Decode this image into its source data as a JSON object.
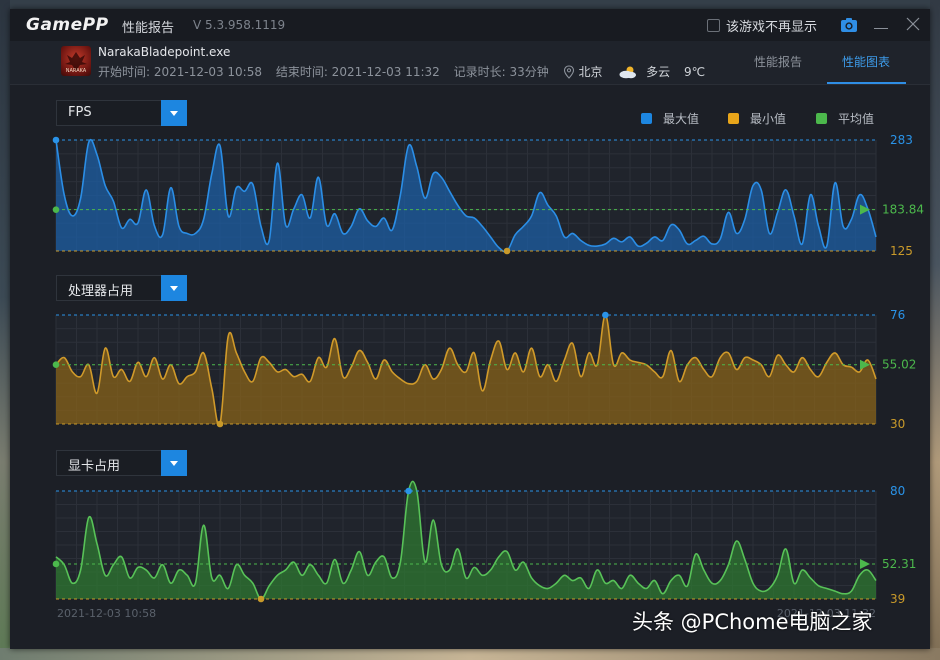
{
  "app": {
    "logo": "GamePP",
    "title": "性能报告",
    "version": "V 5.3.958.1119",
    "dont_show_label": "该游戏不再显示"
  },
  "session": {
    "exe_name": "NarakaBladepoint.exe",
    "icon_text": "NARAKA",
    "start": "开始时间: 2021-12-03 10:58",
    "end": "结束时间: 2021-12-03 11:32",
    "duration": "记录时长: 33分钟",
    "city": "北京",
    "weather": "多云",
    "temperature": "9℃"
  },
  "tabs": [
    {
      "label": "性能报告",
      "active": false
    },
    {
      "label": "性能图表",
      "active": true
    }
  ],
  "legend": [
    {
      "label": "最大值",
      "color": "#1d86e0"
    },
    {
      "label": "最小值",
      "color": "#e8a51a"
    },
    {
      "label": "平均值",
      "color": "#4cb84c"
    }
  ],
  "time_axis": {
    "start": "2021-12-03 10:58",
    "end": "2021-12-03 11:32"
  },
  "charts": [
    {
      "dropdown": "FPS",
      "max_label": "283",
      "avg_label": "183.84",
      "min_label": "125",
      "max": 283,
      "avg": 183.84,
      "min": 125,
      "line_color": "#2b8ee6",
      "fill_color": "#1c5fa8",
      "max_index": 0,
      "min_index": 55,
      "values": [
        283,
        205,
        175,
        200,
        280,
        262,
        218,
        196,
        158,
        170,
        165,
        212,
        161,
        148,
        215,
        160,
        150,
        150,
        170,
        235,
        275,
        175,
        215,
        210,
        220,
        160,
        140,
        250,
        162,
        185,
        205,
        172,
        230,
        162,
        178,
        150,
        160,
        185,
        168,
        160,
        172,
        155,
        205,
        275,
        245,
        200,
        235,
        230,
        210,
        190,
        175,
        172,
        160,
        145,
        130,
        125,
        148,
        160,
        175,
        208,
        190,
        175,
        145,
        150,
        140,
        133,
        132,
        135,
        143,
        138,
        145,
        132,
        136,
        145,
        140,
        162,
        155,
        135,
        140,
        146,
        135,
        142,
        180,
        150,
        170,
        218,
        212,
        150,
        180,
        212,
        175,
        135,
        205,
        160,
        132,
        222,
        160,
        170,
        205,
        185,
        145
      ]
    },
    {
      "dropdown": "处理器占用",
      "max_label": "76",
      "avg_label": "55.02",
      "min_label": "30",
      "max": 76,
      "avg": 55.02,
      "min": 30,
      "line_color": "#d09a2a",
      "fill_color": "#8a6418",
      "max_index": 67,
      "min_index": 20,
      "values": [
        55,
        58,
        52,
        50,
        55,
        43,
        62,
        50,
        53,
        48,
        56,
        50,
        58,
        49,
        55,
        47,
        50,
        52,
        60,
        45,
        30,
        67,
        60,
        52,
        48,
        58,
        56,
        52,
        53,
        50,
        51,
        48,
        58,
        54,
        66,
        50,
        54,
        61,
        56,
        49,
        57,
        52,
        49,
        47,
        48,
        55,
        49,
        53,
        62,
        55,
        52,
        60,
        44,
        57,
        65,
        53,
        60,
        52,
        62,
        50,
        55,
        48,
        57,
        64,
        50,
        60,
        55,
        76,
        55,
        60,
        57,
        56,
        55,
        52,
        50,
        61,
        48,
        55,
        58,
        53,
        50,
        58,
        60,
        53,
        58,
        57,
        55,
        50,
        59,
        55,
        52,
        58,
        53,
        50,
        56,
        60,
        55,
        54,
        52,
        57,
        49
      ]
    },
    {
      "dropdown": "显卡占用",
      "max_label": "80",
      "avg_label": "52.31",
      "min_label": "39",
      "max": 80,
      "avg": 52.31,
      "min": 39,
      "line_color": "#58c258",
      "fill_color": "#2e7a30",
      "max_index": 43,
      "min_index": 25,
      "values": [
        55,
        52,
        45,
        50,
        70,
        60,
        48,
        52,
        55,
        47,
        51,
        50,
        47,
        52,
        45,
        50,
        48,
        45,
        67,
        47,
        48,
        43,
        52,
        48,
        45,
        39,
        44,
        48,
        50,
        53,
        48,
        52,
        48,
        45,
        54,
        45,
        50,
        57,
        48,
        53,
        55,
        47,
        53,
        80,
        80,
        53,
        69,
        52,
        50,
        58,
        47,
        51,
        48,
        50,
        55,
        57,
        50,
        53,
        47,
        44,
        43,
        45,
        48,
        46,
        47,
        43,
        50,
        45,
        46,
        43,
        48,
        45,
        43,
        46,
        41,
        46,
        48,
        44,
        56,
        50,
        45,
        46,
        52,
        61,
        54,
        45,
        42,
        43,
        48,
        58,
        45,
        50,
        47,
        44,
        43,
        42,
        41,
        42,
        48,
        50,
        46
      ]
    }
  ],
  "watermark": "头条 @PChome电脑之家"
}
